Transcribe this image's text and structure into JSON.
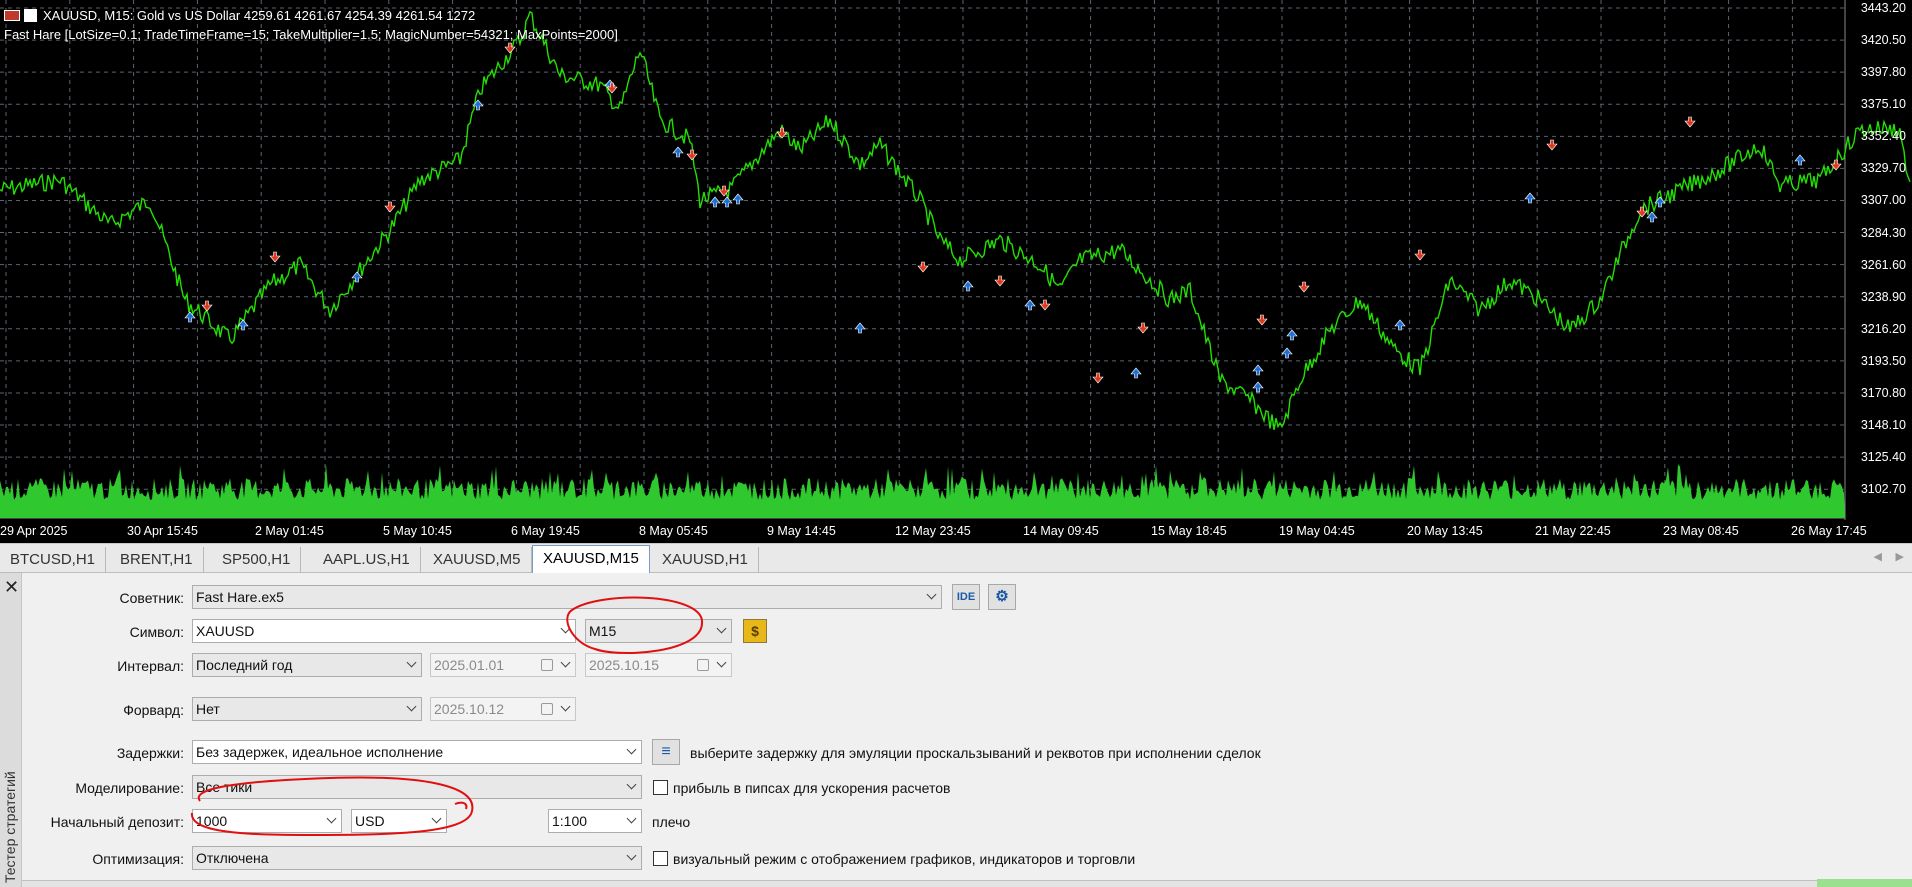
{
  "chart": {
    "title": "XAUUSD, M15:  Gold vs US Dollar  4259.61 4261.67 4254.39 4261.54  1272",
    "ea_line": "Fast Hare [LotSize=0.1; TradeTimeFrame=15; TakeMultiplier=1.5; MagicNumber=54321; MaxPoints=2000]",
    "price_labels": [
      "3443.20",
      "3420.50",
      "3397.80",
      "3375.10",
      "3352.40",
      "3329.70",
      "3307.00",
      "3284.30",
      "3261.60",
      "3238.90",
      "3216.20",
      "3193.50",
      "3170.80",
      "3148.10",
      "3125.40",
      "3102.70"
    ],
    "time_labels": [
      "29 Apr 2025",
      "30 Apr 15:45",
      "2 May 01:45",
      "5 May 10:45",
      "6 May 19:45",
      "8 May 05:45",
      "9 May 14:45",
      "12 May 23:45",
      "14 May 09:45",
      "15 May 18:45",
      "19 May 04:45",
      "20 May 13:45",
      "21 May 22:45",
      "23 May 08:45",
      "26 May 17:45"
    ],
    "colors": {
      "background": "#000000",
      "line": "#22e000",
      "volume": "#2fc92f",
      "grid": "#5a6470",
      "buy_arrow": "#1e6fd6",
      "sell_arrow": "#e03a1e"
    }
  },
  "tabs": [
    "BTCUSD,H1",
    "BRENT,H1",
    "SP500,H1",
    "AAPL.US,H1",
    "XAUUSD,M5",
    "XAUUSD,M15",
    "XAUUSD,H1"
  ],
  "active_tab": "XAUUSD,M15",
  "tester": {
    "vertical_title": "Тестер стратегий",
    "advisor": {
      "label": "Советник:",
      "value": "Fast Hare.ex5",
      "ide": "IDE"
    },
    "symbol": {
      "label": "Символ:",
      "value": "XAUUSD",
      "timeframe": "M15"
    },
    "interval": {
      "label": "Интервал:",
      "value": "Последний год",
      "from": "2025.01.01",
      "to": "2025.10.15"
    },
    "forward": {
      "label": "Форвард:",
      "value": "Нет",
      "date": "2025.10.12"
    },
    "delays": {
      "label": "Задержки:",
      "value": "Без задержек, идеальное исполнение",
      "hint": "выберите задержку для эмуляции проскальзываний и реквотов при исполнении сделок"
    },
    "modeling": {
      "label": "Моделирование:",
      "value": "Все тики",
      "checkbox": "прибыль в пипсах для ускорения расчетов"
    },
    "deposit": {
      "label": "Начальный депозит:",
      "value": "1000",
      "currency": "USD",
      "leverage": "1:100",
      "leverage_label": "плечо"
    },
    "optimization": {
      "label": "Оптимизация:",
      "value": "Отключена",
      "checkbox": "визуальный режим с отображением графиков, индикаторов и торговли"
    }
  }
}
